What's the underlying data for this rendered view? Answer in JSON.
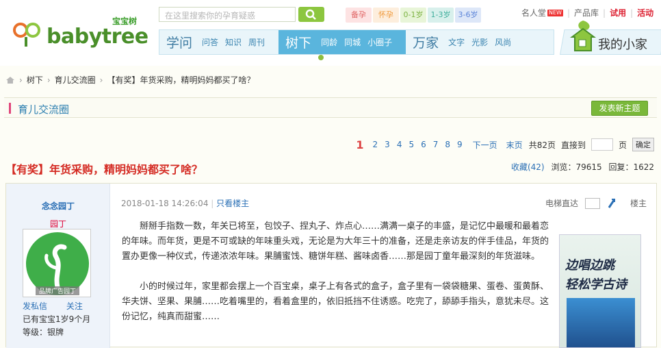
{
  "logo": {
    "cn": "宝宝树",
    "en": "babytree"
  },
  "search": {
    "placeholder": "在这里搜索你的孕育疑惑"
  },
  "stages": [
    {
      "label": "备孕",
      "bg": "#fde3e3",
      "fg": "#e06666"
    },
    {
      "label": "怀孕",
      "bg": "#fdeedd",
      "fg": "#f09a3c"
    },
    {
      "label": "0-1岁",
      "bg": "#e8f5d8",
      "fg": "#7cb342"
    },
    {
      "label": "1-3岁",
      "bg": "#d8f0ec",
      "fg": "#3fae9c"
    },
    {
      "label": "3-6岁",
      "bg": "#dde7f8",
      "fg": "#5b84d8"
    }
  ],
  "toplinks": {
    "celebrity": "名人堂",
    "new": "NEW",
    "products": "产品库",
    "trial": "试用",
    "activity": "活动"
  },
  "nav": [
    {
      "big": "学问",
      "items": [
        "问答",
        "知识",
        "周刊"
      ]
    },
    {
      "big": "树下",
      "items": [
        "同龄",
        "同城",
        "小圈子"
      ]
    },
    {
      "big": "万家",
      "items": [
        "文字",
        "光影",
        "风尚"
      ]
    }
  ],
  "myhome": "我的小家",
  "breadcrumb": [
    "树下",
    "育儿交流圈",
    "【有奖】年货采购，精明妈妈都买了啥？"
  ],
  "board": {
    "name": "育儿交流圈",
    "new_topic": "发表新主题"
  },
  "pager": {
    "current": "1",
    "pages": [
      "2",
      "3",
      "4",
      "5",
      "6",
      "7",
      "8",
      "9"
    ],
    "next": "下一页",
    "last": "末页",
    "total": "共82页",
    "goto": "直接到",
    "page_unit": "页",
    "confirm": "确定"
  },
  "thread": {
    "title": "【有奖】年货采购，精明妈妈都买了啥？",
    "favorite": "收藏(42)",
    "views": "浏览：79615",
    "replies": "回复：1622"
  },
  "user": {
    "name": "念念园丁",
    "rank": "园丁",
    "avatar_tag": "品牌广告园丁",
    "message": "发私信",
    "follow": "关注",
    "baby": "已有宝宝1岁9个月",
    "level": "等级：银牌"
  },
  "post": {
    "time": "2018-01-18 14:26:04",
    "only_op": "只看楼主",
    "elevator": "电梯直达",
    "floor": "楼主",
    "paragraphs": [
      "掰掰手指数一数，年关已将至，包饺子、捏丸子、炸点心……满满一桌子的丰盛，是记忆中最暖和最着恋的年味。而年货，更是不可或缺的年味重头戏，无论是为大年三十的准备，还是走亲访友的伴手佳品，年货的置办更像一种仪式，传递浓浓年味。果脯蜜饯、糖饼年糕、酱味卤香……那是园丁童年最深刻的年货滋味。",
      "小的时候过年，家里都会摆上一个百宝桌，桌子上有各式的盒子，盒子里有一袋袋糖果、蛋卷、蛋黄酥、华夫饼、坚果、果脯……吃着嘴里的，看着盒里的，依旧抵挡不住诱惑。吃完了，舔舔手指头，意犹未尽。这份记忆，纯真而甜蜜……"
    ]
  },
  "ad": {
    "line1": "边唱边跳",
    "line2": "轻松学古诗"
  }
}
